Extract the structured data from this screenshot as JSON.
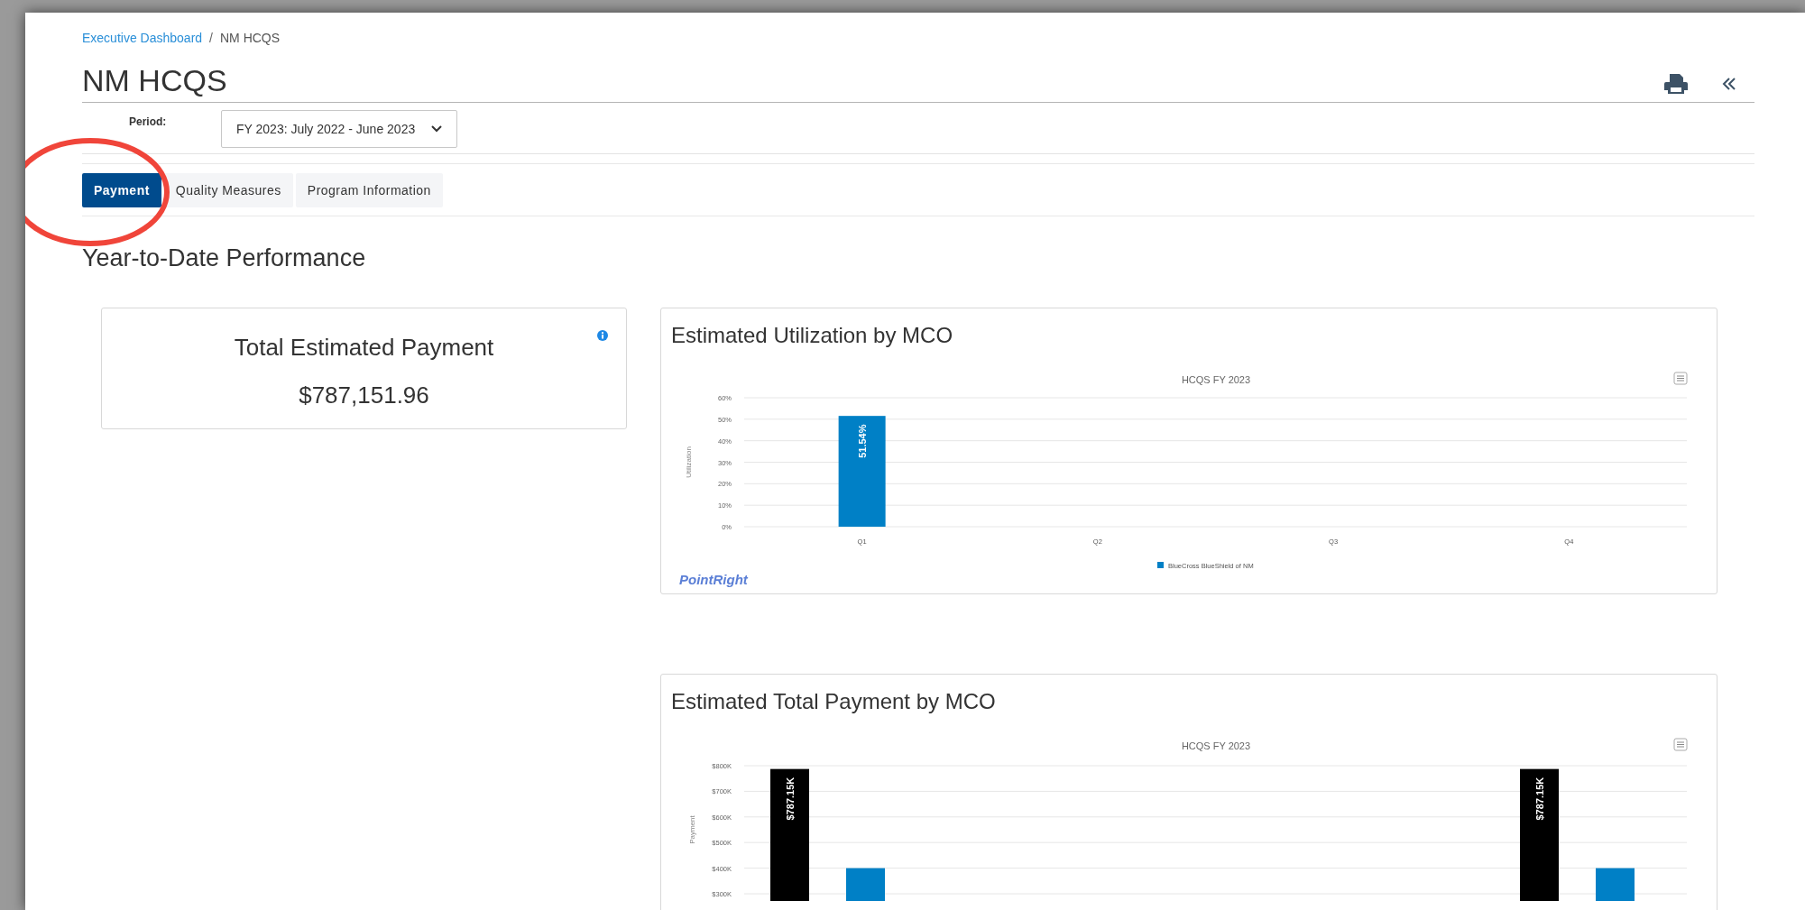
{
  "breadcrumb": {
    "items": [
      {
        "label": "Executive Dashboard",
        "kind": "link"
      },
      {
        "label": "NM HCQS",
        "kind": "current"
      }
    ],
    "separator": "/"
  },
  "page_title": "NM HCQS",
  "period": {
    "label": "Period:",
    "value": "FY 2023: July 2022 - June 2023"
  },
  "tabs": [
    {
      "label": "Payment",
      "selected": true
    },
    {
      "label": "Quality Measures",
      "selected": false
    },
    {
      "label": "Program Information",
      "selected": false
    }
  ],
  "section_title": "Year-to-Date Performance",
  "summary_card": {
    "title": "Total Estimated Payment",
    "value": "$787,151.96"
  },
  "charts": [
    {
      "title": "Estimated Utilization by MCO",
      "footer_logo": "PointRight",
      "chart_data": {
        "type": "bar",
        "grid": true,
        "title": "HCQS FY 2023",
        "ylabel": "Utilization",
        "categories": [
          "Q1",
          "Q2",
          "Q3",
          "Q4"
        ],
        "ylim": [
          0,
          60
        ],
        "yticks": [
          {
            "value": 0,
            "label": "0%"
          },
          {
            "value": 10,
            "label": "10%"
          },
          {
            "value": 20,
            "label": "20%"
          },
          {
            "value": 30,
            "label": "30%"
          },
          {
            "value": 40,
            "label": "40%"
          },
          {
            "value": 50,
            "label": "50%"
          },
          {
            "value": 60,
            "label": "60%"
          }
        ],
        "series": [
          {
            "name": "BlueCross BlueShield of NM",
            "color": "#0080c6",
            "values": [
              51.54,
              null,
              null,
              null
            ],
            "value_labels": [
              "51.54%",
              null,
              null,
              null
            ]
          }
        ]
      }
    },
    {
      "title": "Estimated Total Payment by MCO",
      "chart_data": {
        "type": "bar",
        "grid": true,
        "title": "HCQS FY 2023",
        "ylabel": "Payment",
        "ylim": [
          300000,
          800000
        ],
        "yticks": [
          {
            "value": 300000,
            "label": "$300K"
          },
          {
            "value": 400000,
            "label": "$400K"
          },
          {
            "value": 500000,
            "label": "$500K"
          },
          {
            "value": 600000,
            "label": "$600K"
          },
          {
            "value": 700000,
            "label": "$700K"
          },
          {
            "value": 800000,
            "label": "$800K"
          }
        ],
        "series": [
          {
            "color": "#000000",
            "values": [
              787151.96,
              787151.96
            ],
            "value_labels": [
              "$787.15K",
              "$787.15K"
            ]
          },
          {
            "color": "#0080c6",
            "values": [
              400000,
              400000
            ]
          }
        ]
      }
    }
  ]
}
